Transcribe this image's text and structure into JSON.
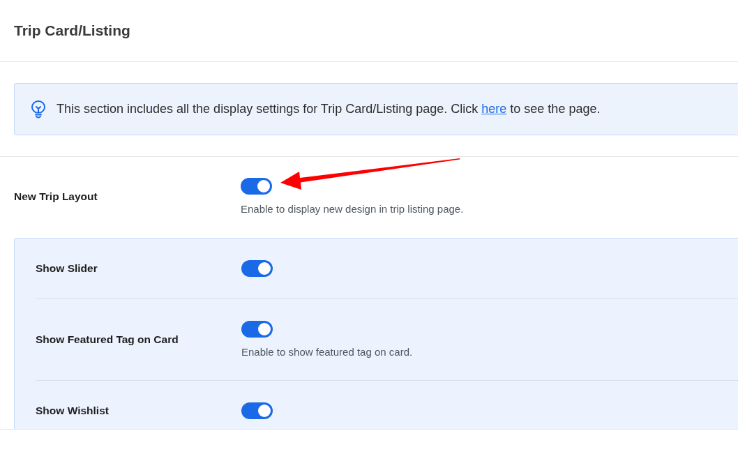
{
  "page": {
    "title": "Trip Card/Listing"
  },
  "notice": {
    "text_before": "This section includes all the display settings for Trip Card/Listing page. Click",
    "link": "here",
    "text_after": "to see the page."
  },
  "settings": [
    {
      "label": "New Trip Layout",
      "on": true,
      "description": "Enable to display new design in trip listing page.",
      "children": [
        {
          "label": "Show Slider",
          "on": true
        },
        {
          "label": "Show Featured Tag on Card",
          "on": true,
          "description": "Enable to show featured tag on card."
        },
        {
          "label": "Show Wishlist",
          "on": true
        }
      ]
    }
  ]
}
